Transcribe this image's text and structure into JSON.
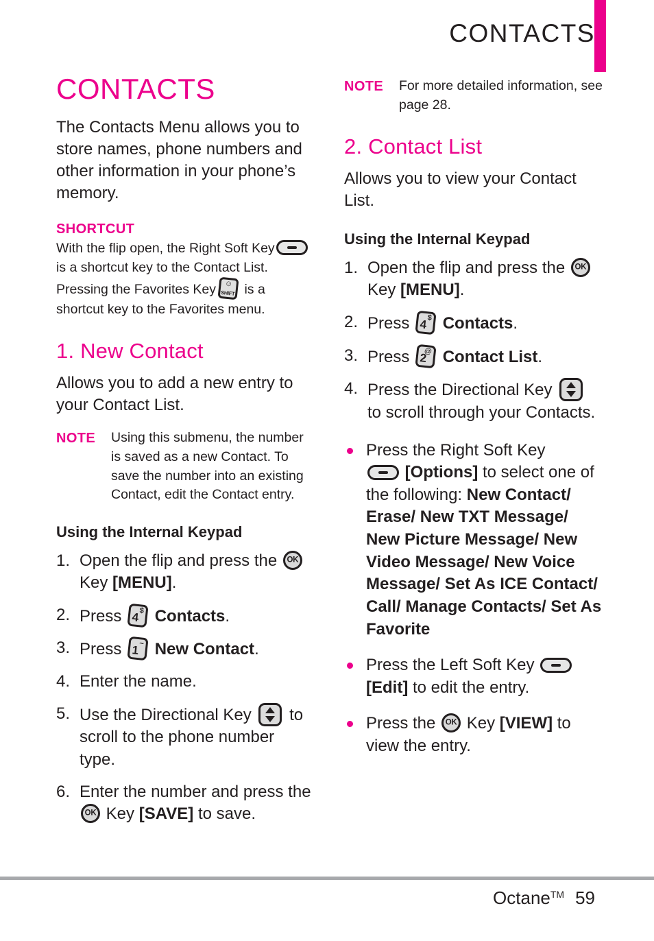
{
  "header": {
    "title": "CONTACTS",
    "accent_color": "#ec008c"
  },
  "footer": {
    "product": "Octane",
    "trademark": "TM",
    "page_number": "59"
  },
  "left_column": {
    "title": "CONTACTS",
    "intro": "The Contacts Menu allows you to store names, phone numbers and other information in your phone’s memory.",
    "shortcut": {
      "label": "SHORTCUT",
      "text_1": "With the flip open, the Right Soft Key",
      "text_2": "is a shortcut key to the Contact List. Pressing the Favorites Key",
      "text_3": "is a shortcut key to the Favorites menu."
    },
    "section": {
      "heading": "1. New Contact",
      "description": "Allows you to add a new entry to your Contact List.",
      "note_tag": "NOTE",
      "note_text": "Using this submenu, the number is saved as a new Contact. To save the number into an existing Contact, edit the Contact entry.",
      "keypad_heading": "Using the Internal Keypad",
      "steps": {
        "s1_num": "1.",
        "s1_a": "Open the flip and press the",
        "s1_b": "Key",
        "s1_bold": "[MENU]",
        "s1_c": ".",
        "s2_num": "2.",
        "s2_a": "Press",
        "s2_key_digit": "4",
        "s2_key_symbol": "$",
        "s2_bold": "Contacts",
        "s2_c": ".",
        "s3_num": "3.",
        "s3_a": "Press",
        "s3_key_digit": "1",
        "s3_key_symbol": "~",
        "s3_bold": "New Contact",
        "s3_c": ".",
        "s4_num": "4.",
        "s4_a": "Enter the name.",
        "s5_num": "5.",
        "s5_a": "Use the Directional Key",
        "s5_b": "to scroll to the phone number type.",
        "s6_num": "6.",
        "s6_a": "Enter the number and press the",
        "s6_b": "Key",
        "s6_bold": "[SAVE]",
        "s6_c": "to save."
      }
    }
  },
  "right_column": {
    "note_tag": "NOTE",
    "note_text": "For more detailed information, see page 28.",
    "section": {
      "heading": "2. Contact List",
      "description": "Allows you to view your Contact List.",
      "keypad_heading": "Using the Internal Keypad",
      "steps": {
        "s1_num": "1.",
        "s1_a": "Open the flip and press the",
        "s1_b": "Key",
        "s1_bold": "[MENU]",
        "s1_c": ".",
        "s2_num": "2.",
        "s2_a": "Press",
        "s2_key_digit": "4",
        "s2_key_symbol": "$",
        "s2_bold": "Contacts",
        "s2_c": ".",
        "s3_num": "3.",
        "s3_a": "Press",
        "s3_key_digit": "2",
        "s3_key_symbol": "@",
        "s3_bold": "Contact List",
        "s3_c": ".",
        "s4_num": "4.",
        "s4_a": "Press the Directional Key",
        "s4_b": "to scroll through your Contacts."
      },
      "bullets": {
        "b1_a": "Press the Right Soft Key",
        "b1_bold": "[Options]",
        "b1_b": "to select one of the following:",
        "b1_options": "New Contact/ Erase/ New TXT Message/ New Picture Message/ New Video Message/ New Voice Message/ Set As ICE Contact/ Call/ Manage Contacts/ Set As Favorite",
        "b2_a": "Press the Left Soft Key",
        "b2_bold": "[Edit]",
        "b2_b": "to edit the entry.",
        "b3_a": "Press the",
        "b3_b": "Key",
        "b3_bold": "[VIEW]",
        "b3_c": "to view the entry."
      }
    }
  },
  "icons": {
    "soft_key": "soft-key-icon",
    "ok_key": "ok-key-icon",
    "ok_label": "OK",
    "directional_key": "directional-key-icon",
    "shift_key": "shift-key-icon",
    "shift_label": "SHIFT",
    "shift_glyph": "☺"
  }
}
